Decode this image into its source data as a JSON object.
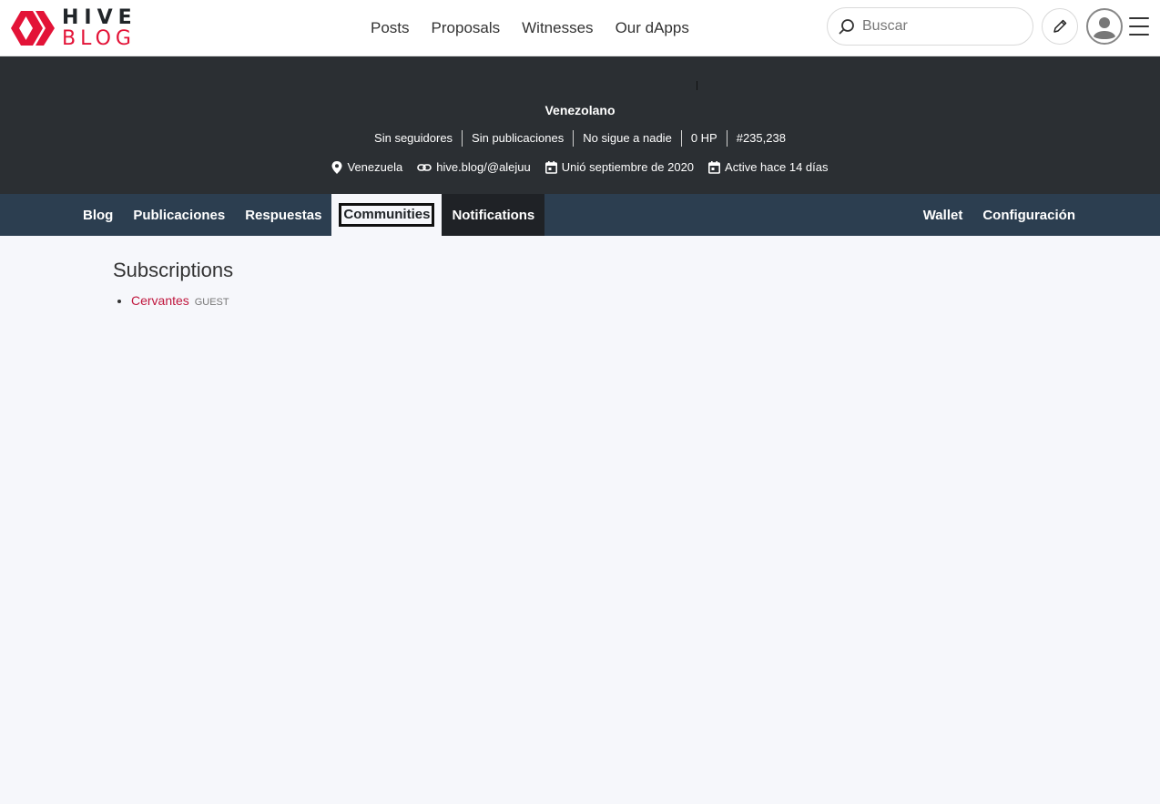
{
  "brand": {
    "line1": "HIVE",
    "line2": "BLOG",
    "accent": "#e31337"
  },
  "nav": {
    "items": [
      "Posts",
      "Proposals",
      "Witnesses",
      "Our dApps"
    ]
  },
  "search": {
    "placeholder": "Buscar",
    "icon": "search-icon"
  },
  "toolbar": {
    "compose_icon": "pencil-icon",
    "avatar_icon": "user-avatar-icon",
    "menu_icon": "hamburger-menu-icon"
  },
  "profile": {
    "name": "Venezolano",
    "stats": [
      "Sin seguidores",
      "Sin publicaciones",
      "No sigue a nadie",
      "0 HP",
      "#235,238"
    ],
    "location": "Venezuela",
    "website": "hive.blog/@alejuu",
    "joined": "Unió septiembre de 2020",
    "active": "Active hace 14 días"
  },
  "tabs": {
    "left": [
      "Blog",
      "Publicaciones",
      "Respuestas",
      "Communities",
      "Notifications"
    ],
    "active": "Communities",
    "right": [
      "Wallet",
      "Configuración"
    ]
  },
  "subscriptions": {
    "title": "Subscriptions",
    "items": [
      {
        "name": "Cervantes",
        "role": "GUEST"
      }
    ]
  }
}
